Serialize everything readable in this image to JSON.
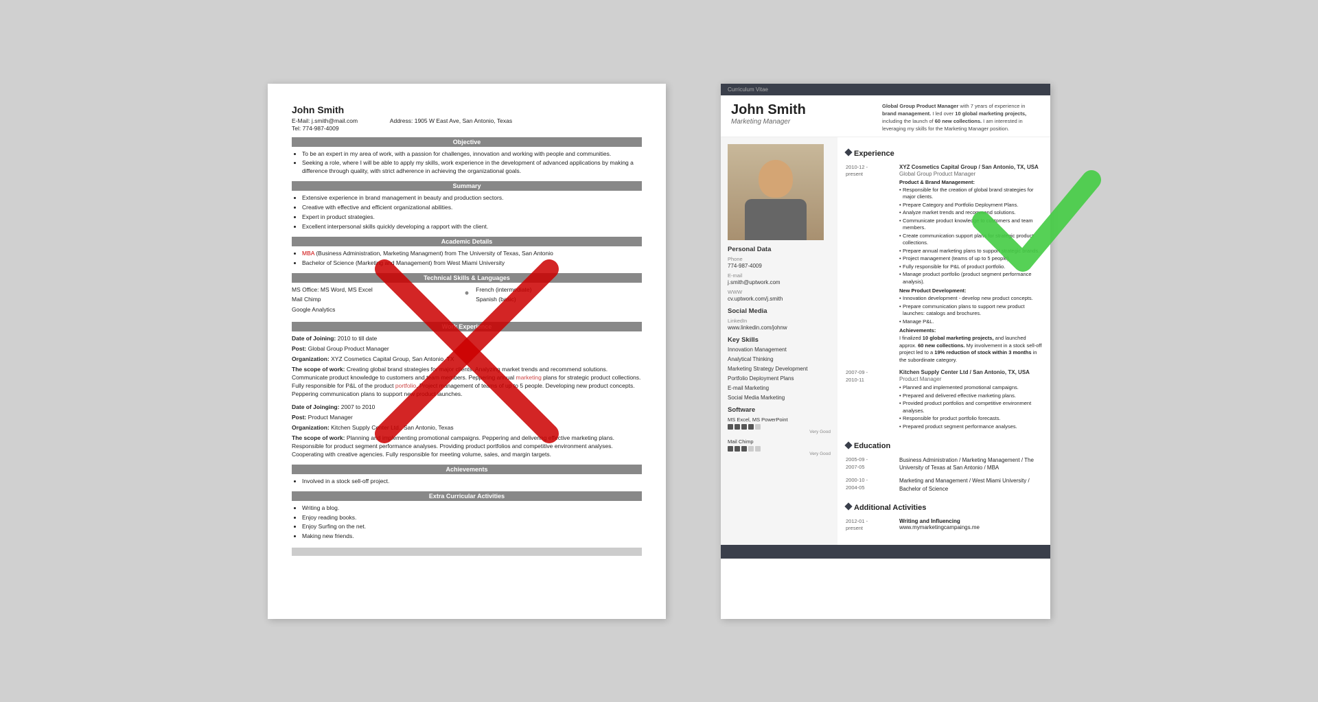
{
  "page": {
    "background": "#d0d0d0"
  },
  "left_resume": {
    "name": "John Smith",
    "email_label": "E-Mail:",
    "email": "j.smith@mail.com",
    "address_label": "Address:",
    "address": "1905 W East Ave, San Antonio, Texas",
    "tel_label": "Tel:",
    "tel": "774-987-4009",
    "sections": {
      "objective": {
        "title": "Objective",
        "bullets": [
          "To be an expert in my area of work, with a passion for challenges, innovation and working with people and communities.",
          "Seeking a role, where I will be able to apply my skills, work experience in the development of advanced applications by making a difference through quality, with strict adherence in achieving the organizational goals."
        ]
      },
      "summary": {
        "title": "Summary",
        "bullets": [
          "Extensive experience in brand management in beauty and production sectors.",
          "Creative with effective and efficient organizational abilities.",
          "Expert in product strategies.",
          "Excellent interpersonal skills quickly developing a rapport with the client."
        ]
      },
      "academic": {
        "title": "Academic Details",
        "items": [
          "MBA (Business Administration, Marketing Managment) from The University of Texas, San Antonio",
          "Bachelor of Science (Marketing and Management) from West Miami University"
        ]
      },
      "technical": {
        "title": "Technical Skills & Languages",
        "items_left": [
          "MS Office: MS Word, MS Excel",
          "Mail Chimp",
          "Google Analytics"
        ],
        "items_right": [
          "French (intermediate)",
          "Spanish (basic)"
        ]
      },
      "work_experience": {
        "title": "Work Experience",
        "entries": [
          {
            "date_of_joining": "Date of Joining: 2010 to till date",
            "post": "Post: Global Group Product Manager",
            "organization": "Organization: XYZ Cosmetics Capital Group, San Antonio, TX",
            "scope": "The scope of work: Creating global brand strategies for major clients. Analyzing market trends and recommend solutions. Communicate product knowledge to customers and team members. Peppering annual marketing plans for strategic product collections. Fully responsible for P&L of the product portfolio. Project management of teams of up to 5 people. Developing new product concepts. Peppering communication plans to support new product launches."
          },
          {
            "date_of_joining": "Date of Joinging: 2007 to 2010",
            "post": "Post: Product Manager",
            "organization": "Organization: Kitchen Supply Center Ltd., San Antonio, Texas",
            "scope": "The scope of work: Planning and implementing promotional campaigns. Peppering and delivering effective marketing plans. Responsible for product segment performance analyses. Providing product portfolios and competitive environment analyses. Cooperating with creative agencies. Fully responsible for meeting volume, sales, and margin targets."
          }
        ]
      },
      "achievements": {
        "title": "Achievements",
        "items": [
          "Involved in a stock sell-off project."
        ]
      },
      "extra": {
        "title": "Extra Curricular Activities",
        "items": [
          "Writing a blog.",
          "Enjoy reading books.",
          "Enjoy Surfing on the net.",
          "Making new friends."
        ]
      }
    }
  },
  "right_resume": {
    "cv_label": "Curriculum Vitae",
    "name": "John Smith",
    "title": "Marketing Manager",
    "summary": "Global Group Product Manager with 7 years of experience in brand management. I led over 10 global marketing projects, including the launch of 60 new collections. I am interested in leveraging my skills for the Marketing Manager position.",
    "personal_data": {
      "section_title": "Personal Data",
      "phone_label": "Phone",
      "phone": "774-987-4009",
      "email_label": "E-mail",
      "email": "j.smith@uptwork.com",
      "www_label": "WWW",
      "www": "cv.uptwork.com/j.smith"
    },
    "social": {
      "section_title": "Social Media",
      "linkedin_label": "LinkedIn",
      "linkedin": "www.linkedin.com/johnw"
    },
    "skills": {
      "section_title": "Key Skills",
      "items": [
        "Innovation Management",
        "Analytical Thinking",
        "Marketing Strategy Development",
        "Portfolio Deployment Plans",
        "E-mail Marketing",
        "Social Media Marketing"
      ]
    },
    "software": {
      "section_title": "Software",
      "items": [
        {
          "name": "MS Excel, MS PowerPoint",
          "filled": 4,
          "empty": 1,
          "label": "Very Good"
        },
        {
          "name": "Mail Chimp",
          "filled": 3,
          "empty": 2,
          "label": "Very Good"
        }
      ]
    },
    "experience": {
      "section_title": "Experience",
      "entries": [
        {
          "dates": "2010-12 - present",
          "company": "XYZ Cosmetics Capital Group / San Antonio, TX, USA",
          "role": "Global Group Product Manager",
          "subtitle1": "Product & Brand Management:",
          "bullets1": [
            "Responsible for the creation of global brand strategies for major clients.",
            "Prepare Category and Portfolio Deployment Plans.",
            "Analyze market trends and recommend solutions.",
            "Communicate product knowledge to customers and team members.",
            "Create communication support plans for strategic product collections.",
            "Prepare annual marketing plans to support strategic brands.",
            "Project management (teams of up to 5 people).",
            "Fully responsible for P&L of product portfolio.",
            "Manage product portfolio (product segment performance analysis)."
          ],
          "subtitle2": "New Product Development:",
          "bullets2": [
            "Innovation development - develop new product concepts.",
            "Prepare communication plans to support new product launches: catalogs and brochures.",
            "Manage P&L."
          ],
          "subtitle3": "Achievements:",
          "achievement_text": "I finalized 10 global marketing projects, and launched approx. 60 new collections. My involvement in a stock sell-off project led to a 19% reduction of stock within 3 months in the subordinate category."
        },
        {
          "dates": "2007-09 - 2010-11",
          "company": "Kitchen Supply Center Ltd / San Antonio, TX, USA",
          "role": "Product Manager",
          "bullets": [
            "Planned and implemented promotional campaigns.",
            "Prepared and delivered effective marketing plans.",
            "Provided product portfolios and competitive environment analyses.",
            "Responsible for product portfolio forecasts.",
            "Prepared product segment performance analyses."
          ]
        }
      ]
    },
    "education": {
      "section_title": "Education",
      "entries": [
        {
          "dates": "2005-09 - 2007-05",
          "detail": "Business Administration / Marketing Management / The University of Texas at San Antonio / MBA"
        },
        {
          "dates": "2000-10 - 2004-05",
          "detail": "Marketing and Management / West Miami University / Bachelor of Science"
        }
      ]
    },
    "activities": {
      "section_title": "Additional Activities",
      "entries": [
        {
          "dates": "2012-01 - present",
          "detail": "Writing and Influencing\nwww.mymarketingcampaings.me"
        }
      ]
    }
  }
}
